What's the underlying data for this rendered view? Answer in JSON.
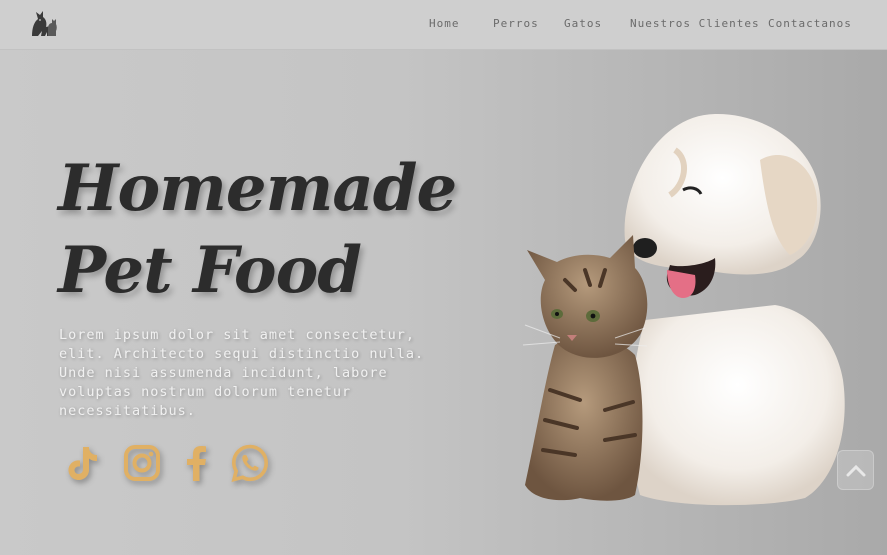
{
  "nav": {
    "logo_icon": "dog-and-cat-logo-icon",
    "links": [
      "Home",
      "Perros",
      "Gatos",
      "Nuestros Clientes",
      "Contactanos"
    ]
  },
  "hero": {
    "title_line1": "Homemade",
    "title_line2": "Pet Food",
    "description": "Lorem ipsum dolor sit amet consectetur, elit. Architecto sequi distinctio nulla. Unde nisi assumenda incidunt, labore voluptas nostrum dolorum tenetur necessitatibus.",
    "image_icon": "puppy-and-kitten-image"
  },
  "socials": [
    "tiktok-icon",
    "instagram-icon",
    "facebook-icon",
    "whatsapp-icon"
  ],
  "scroll_top_icon": "chevron-up-icon",
  "colors": {
    "accent": "#e0b064",
    "title": "#2c2c2c",
    "nav_text": "#6b6b6b",
    "background": "#c4c4c4"
  }
}
